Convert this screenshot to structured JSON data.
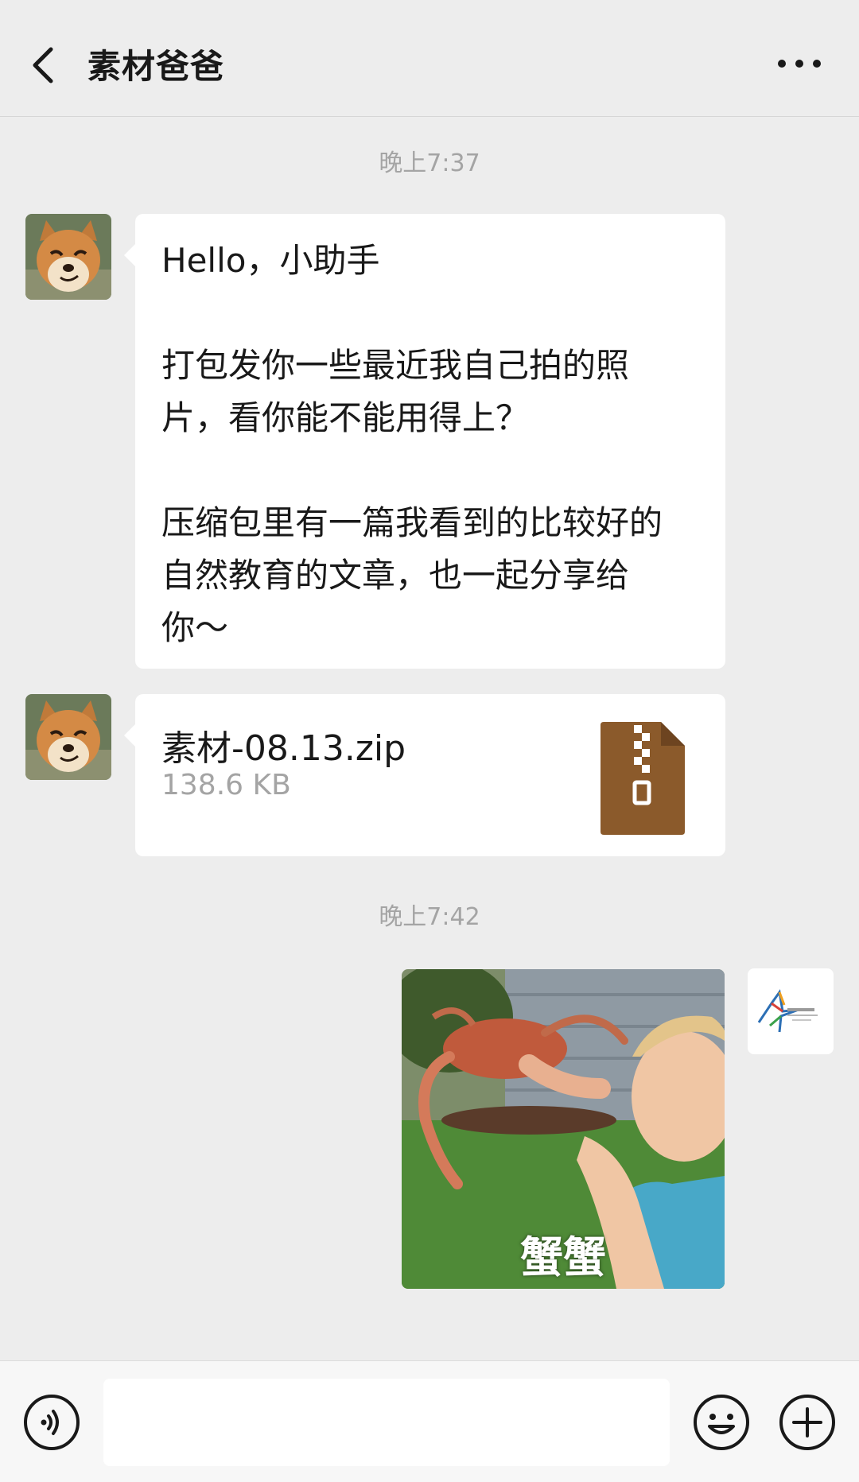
{
  "header": {
    "title": "素材爸爸"
  },
  "messages": [
    {
      "timestamp": "晚上7:37",
      "text": "Hello，小助手\n\n打包发你一些最近我自己拍的照\n片，看你能不能用得上？\n\n压缩包里有一篇我看到的比较好的\n自然教育的文章，也一起分享给\n你～"
    },
    {
      "file_name": "素材-08.13.zip",
      "file_size": "138.6 KB",
      "file_icon_color": "#8b5a2b"
    },
    {
      "timestamp": "晚上7:42",
      "image_caption": "蟹蟹"
    }
  ],
  "input_bar": {
    "placeholder": ""
  },
  "icons": [
    "back-arrow-icon",
    "more-icon",
    "voice-icon",
    "emoji-icon",
    "plus-icon",
    "zip-file-icon"
  ]
}
